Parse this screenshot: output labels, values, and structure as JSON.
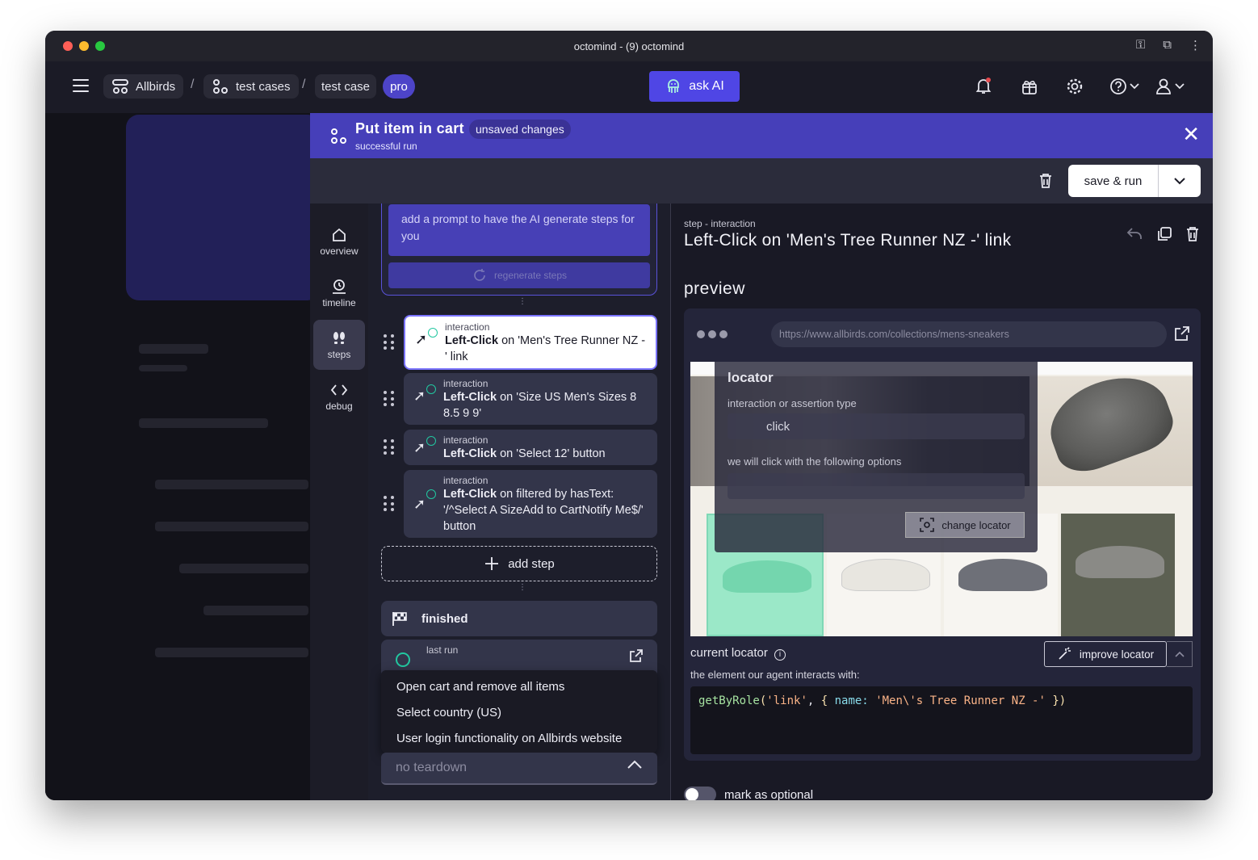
{
  "window": {
    "title": "octomind - (9) octomind"
  },
  "breadcrumb": {
    "items": [
      "Allbirds",
      "test cases",
      "test case"
    ],
    "separator": "/",
    "plan_badge": "pro"
  },
  "appbar": {
    "ask_ai_label": "ask AI",
    "icons": [
      "bell-icon",
      "gift-icon",
      "gear-icon",
      "help-icon",
      "user-icon"
    ]
  },
  "header": {
    "title": "Put item in cart",
    "badge": "unsaved changes",
    "subtitle": "successful run"
  },
  "toolbar": {
    "save_run_label": "save & run"
  },
  "nav": {
    "items": [
      {
        "label": "overview",
        "icon": "home-icon"
      },
      {
        "label": "timeline",
        "icon": "timeline-icon"
      },
      {
        "label": "steps",
        "icon": "steps-icon"
      },
      {
        "label": "debug",
        "icon": "code-icon"
      }
    ]
  },
  "prompt": {
    "text": "add a prompt to have the AI generate steps for you",
    "regenerate_label": "regenerate steps"
  },
  "steps": [
    {
      "kind": "interaction",
      "action": "Left-Click",
      "target": " on 'Men's Tree Runner NZ - ' link"
    },
    {
      "kind": "interaction",
      "action": "Left-Click",
      "target": " on 'Size US Men's Sizes 8 8.5 9 9'"
    },
    {
      "kind": "interaction",
      "action": "Left-Click",
      "target": " on 'Select 12' button"
    },
    {
      "kind": "interaction",
      "action": "Left-Click",
      "target": " on filtered by hasText: '/^Select A SizeAdd to CartNotify Me$/' button"
    }
  ],
  "add_step_label": "add step",
  "finished_label": "finished",
  "last_run_label": "last run",
  "teardown": {
    "options": [
      "Open cart and remove all items",
      "Select country (US)",
      "User login functionality on Allbirds website"
    ],
    "placeholder": "no teardown"
  },
  "detail": {
    "kind": "step - interaction",
    "title": "Left-Click on 'Men's Tree Runner NZ -' link",
    "preview_label": "preview",
    "url": "https://www.allbirds.com/collections/mens-sneakers",
    "locator_panel": {
      "title": "locator",
      "type_label": "interaction or assertion type",
      "type_value": "click",
      "options_label": "we will click with the following options",
      "change_locator_label": "change locator"
    },
    "current_locator_label": "current locator",
    "improve_locator_label": "improve locator",
    "agent_label": "the element our agent interacts with:",
    "code": {
      "fn": "getByRole",
      "arg1": "'link'",
      "key": "name:",
      "arg2": "'Men\\'s Tree Runner NZ -'"
    },
    "optional_label": "mark as optional"
  },
  "colors": {
    "accent": "#4f46e5",
    "header": "#463fb9",
    "success": "#22c7a0",
    "notification": "#e5484d"
  }
}
